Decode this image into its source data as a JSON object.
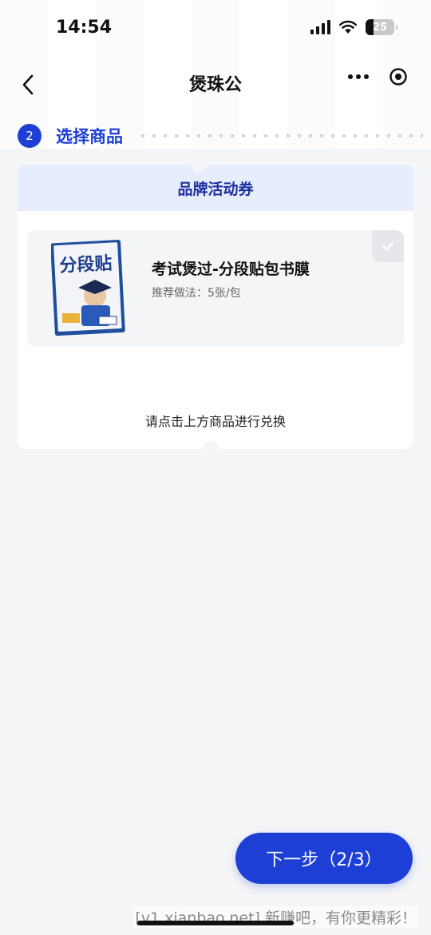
{
  "status_bar": {
    "time": "14:54",
    "battery": "25"
  },
  "nav": {
    "title": "煲珠公"
  },
  "step": {
    "number": "2",
    "label": "选择商品"
  },
  "coupon": {
    "header": "品牌活动券",
    "product": {
      "title": "考试煲过-分段贴包书膜",
      "recommendation": "推荐做法：5张/包",
      "selected": false
    },
    "hint": "请点击上方商品进行兑换"
  },
  "next_button": {
    "label": "下一步（2/3）"
  },
  "watermark": "[v1.xianbao.net] 新赚吧，有你更精彩！",
  "colors": {
    "accent": "#1d3fd6",
    "header_bg": "#e8edfd",
    "header_text": "#1b2f9e",
    "page_bg": "#f4f5f7"
  },
  "icons": {
    "back": "chevron-left-icon",
    "more": "more-dots-icon",
    "close_target": "target-icon",
    "check": "check-icon"
  }
}
